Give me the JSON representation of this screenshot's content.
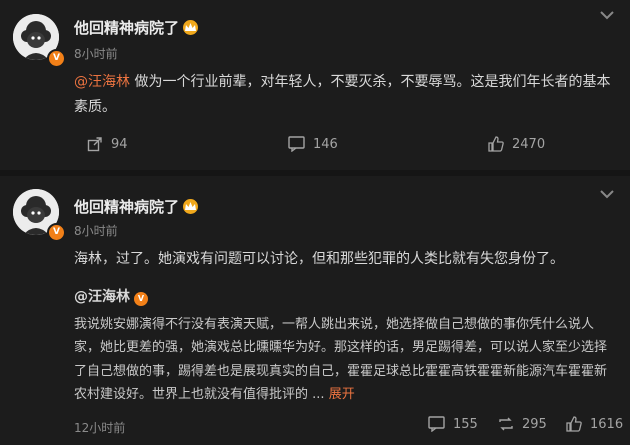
{
  "post1": {
    "username": "他回精神病院了",
    "time": "8小时前",
    "mention": "@汪海林",
    "text": " 做为一个行业前辈，对年轻人，不要灭杀，不要辱骂。这是我们年长者的基本素质。",
    "share_count": "94",
    "comment_count": "146",
    "like_count": "2470"
  },
  "post2": {
    "username": "他回精神病院了",
    "time": "8小时前",
    "text": "海林，过了。她演戏有问题可以讨论，但和那些犯罪的人类比就有失您身份了。",
    "quote": {
      "author": "@汪海林",
      "text": "我说姚安娜演得不行没有表演天赋，一帮人跳出来说，她选择做自己想做的事你凭什么说人家，她比更差的强，她演戏总比曛曛华为好。那这样的话，男足踢得差，可以说人家至少选择了自己想做的事，踢得差也是展现真实的自己，霍霍足球总比霍霍高铁霍霍新能源汽车霍霍新农村建设好。世界上也就没有值得批评的 ",
      "ellipsis": "...",
      "expand_label": "展开",
      "time": "12小时前",
      "comment_count": "155",
      "retweet_count": "295",
      "like_count": "1616"
    }
  },
  "badge": "V"
}
